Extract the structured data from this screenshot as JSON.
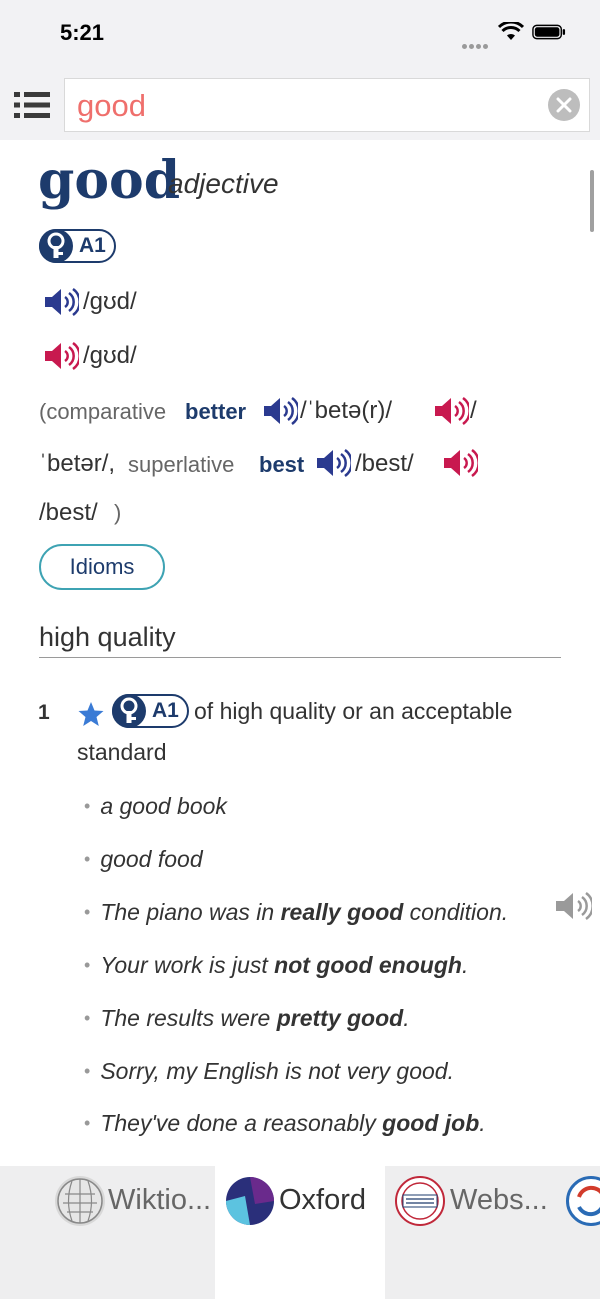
{
  "status": {
    "time": "5:21"
  },
  "search": {
    "value": "good"
  },
  "entry": {
    "headword": "good",
    "part_of_speech": "adjective",
    "level": "A1",
    "pron_uk": "/ɡʊd/",
    "pron_us": "/ɡʊd/",
    "forms": {
      "open": "(comparative ",
      "comparative": "better",
      "comp_uk": "/ˈbetə(r)/",
      "comp_us_a": "/",
      "comp_us_b": "ˈbetər/,",
      "sup_label": " superlative ",
      "superlative": "best",
      "sup_uk": "/best/",
      "sup_us": "/best/",
      "close": ")"
    },
    "idioms_label": "Idioms",
    "shortcut": "high quality",
    "sense": {
      "number": "1",
      "level": "A1",
      "definition_line1": "of high quality or an acceptable",
      "definition_line2": "standard",
      "examples": [
        {
          "pre": "a good book",
          "bold": "",
          "post": ""
        },
        {
          "pre": "good food",
          "bold": "",
          "post": ""
        },
        {
          "pre": "The piano was in ",
          "bold": "really good",
          "post": " condition."
        },
        {
          "pre": "Your work is just ",
          "bold": "not good enough",
          "post": "."
        },
        {
          "pre": "The results were ",
          "bold": "pretty good",
          "post": "."
        },
        {
          "pre": "Sorry, my English is not very good.",
          "bold": "",
          "post": ""
        },
        {
          "pre": "They've done a reasonably ",
          "bold": "good job",
          "post": "."
        }
      ]
    }
  },
  "tabs": [
    {
      "label": "Wiktio...",
      "icon": "wikipedia-globe-icon"
    },
    {
      "label": "Oxford",
      "icon": "oxford-logo-icon",
      "active": true
    },
    {
      "label": "Webs...",
      "icon": "merriam-webster-logo-icon"
    }
  ],
  "colors": {
    "headword": "#1d3b6c",
    "search_text": "#ef6f6c",
    "uk_speaker": "#2b3a8f",
    "us_speaker": "#c8194f",
    "idioms_border": "#3ea3b3"
  }
}
